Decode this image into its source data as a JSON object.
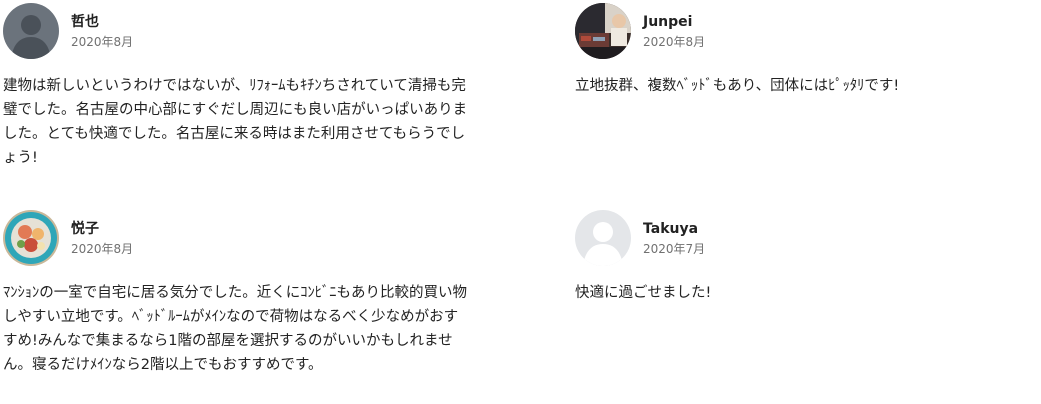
{
  "reviews": [
    {
      "name": "哲也",
      "date": "2020年8月",
      "avatar": "avatar-silhouette-dark",
      "text": "建物は新しいというわけではないが、ﾘﾌｫｰﾑもｷﾁﾝちされていて清掃も完璧でした。名古屋の中心部にすぐだし周辺にも良い店がいっぱいありました。とても快適でした。名古屋に来る時はまた利用させてもらうでしょう!"
    },
    {
      "name": "Junpei",
      "date": "2020年8月",
      "avatar": "avatar-photo-dj",
      "text": "立地抜群、複数ﾍﾞｯﾄﾞもあり、団体にはﾋﾟｯﾀﾘです!"
    },
    {
      "name": "悦子",
      "date": "2020年8月",
      "avatar": "avatar-photo-food",
      "text": "ﾏﾝｼｮﾝの一室で自宅に居る気分でした。近くにｺﾝﾋﾞﾆもあり比較的買い物しやすい立地です。ﾍﾞｯﾄﾞﾙｰﾑがﾒｲﾝなので荷物はなるべく少なめがおすすめ!みんなで集まるなら1階の部屋を選択するのがいいかもしれません。寝るだけﾒｲﾝなら2階以上でもおすすめです。"
    },
    {
      "name": "Takuya",
      "date": "2020年7月",
      "avatar": "avatar-silhouette-light",
      "text": "快適に過ごせました!"
    }
  ],
  "colors": {
    "text": "#222222",
    "date": "#717171",
    "silhouette_dark_bg": "#6b737c",
    "silhouette_light_bg": "#e4e6e9"
  }
}
